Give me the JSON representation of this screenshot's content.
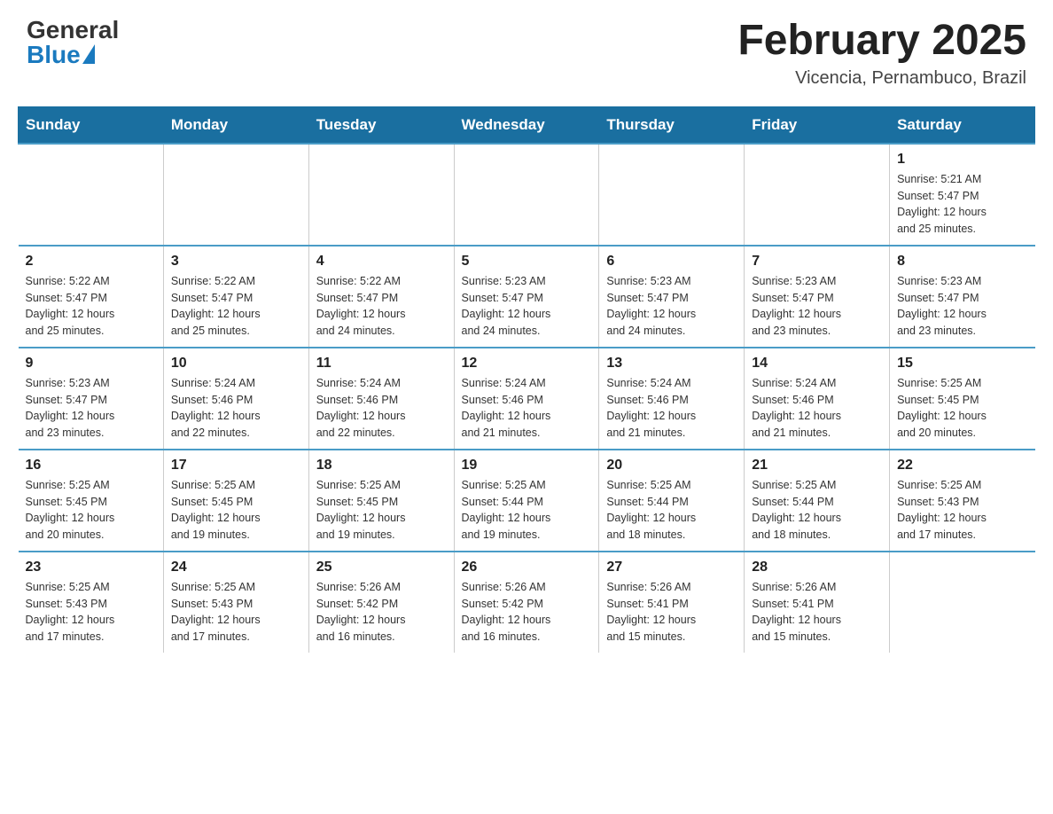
{
  "logo": {
    "general": "General",
    "blue": "Blue"
  },
  "title": "February 2025",
  "location": "Vicencia, Pernambuco, Brazil",
  "days_of_week": [
    "Sunday",
    "Monday",
    "Tuesday",
    "Wednesday",
    "Thursday",
    "Friday",
    "Saturday"
  ],
  "weeks": [
    [
      {
        "day": "",
        "info": ""
      },
      {
        "day": "",
        "info": ""
      },
      {
        "day": "",
        "info": ""
      },
      {
        "day": "",
        "info": ""
      },
      {
        "day": "",
        "info": ""
      },
      {
        "day": "",
        "info": ""
      },
      {
        "day": "1",
        "info": "Sunrise: 5:21 AM\nSunset: 5:47 PM\nDaylight: 12 hours\nand 25 minutes."
      }
    ],
    [
      {
        "day": "2",
        "info": "Sunrise: 5:22 AM\nSunset: 5:47 PM\nDaylight: 12 hours\nand 25 minutes."
      },
      {
        "day": "3",
        "info": "Sunrise: 5:22 AM\nSunset: 5:47 PM\nDaylight: 12 hours\nand 25 minutes."
      },
      {
        "day": "4",
        "info": "Sunrise: 5:22 AM\nSunset: 5:47 PM\nDaylight: 12 hours\nand 24 minutes."
      },
      {
        "day": "5",
        "info": "Sunrise: 5:23 AM\nSunset: 5:47 PM\nDaylight: 12 hours\nand 24 minutes."
      },
      {
        "day": "6",
        "info": "Sunrise: 5:23 AM\nSunset: 5:47 PM\nDaylight: 12 hours\nand 24 minutes."
      },
      {
        "day": "7",
        "info": "Sunrise: 5:23 AM\nSunset: 5:47 PM\nDaylight: 12 hours\nand 23 minutes."
      },
      {
        "day": "8",
        "info": "Sunrise: 5:23 AM\nSunset: 5:47 PM\nDaylight: 12 hours\nand 23 minutes."
      }
    ],
    [
      {
        "day": "9",
        "info": "Sunrise: 5:23 AM\nSunset: 5:47 PM\nDaylight: 12 hours\nand 23 minutes."
      },
      {
        "day": "10",
        "info": "Sunrise: 5:24 AM\nSunset: 5:46 PM\nDaylight: 12 hours\nand 22 minutes."
      },
      {
        "day": "11",
        "info": "Sunrise: 5:24 AM\nSunset: 5:46 PM\nDaylight: 12 hours\nand 22 minutes."
      },
      {
        "day": "12",
        "info": "Sunrise: 5:24 AM\nSunset: 5:46 PM\nDaylight: 12 hours\nand 21 minutes."
      },
      {
        "day": "13",
        "info": "Sunrise: 5:24 AM\nSunset: 5:46 PM\nDaylight: 12 hours\nand 21 minutes."
      },
      {
        "day": "14",
        "info": "Sunrise: 5:24 AM\nSunset: 5:46 PM\nDaylight: 12 hours\nand 21 minutes."
      },
      {
        "day": "15",
        "info": "Sunrise: 5:25 AM\nSunset: 5:45 PM\nDaylight: 12 hours\nand 20 minutes."
      }
    ],
    [
      {
        "day": "16",
        "info": "Sunrise: 5:25 AM\nSunset: 5:45 PM\nDaylight: 12 hours\nand 20 minutes."
      },
      {
        "day": "17",
        "info": "Sunrise: 5:25 AM\nSunset: 5:45 PM\nDaylight: 12 hours\nand 19 minutes."
      },
      {
        "day": "18",
        "info": "Sunrise: 5:25 AM\nSunset: 5:45 PM\nDaylight: 12 hours\nand 19 minutes."
      },
      {
        "day": "19",
        "info": "Sunrise: 5:25 AM\nSunset: 5:44 PM\nDaylight: 12 hours\nand 19 minutes."
      },
      {
        "day": "20",
        "info": "Sunrise: 5:25 AM\nSunset: 5:44 PM\nDaylight: 12 hours\nand 18 minutes."
      },
      {
        "day": "21",
        "info": "Sunrise: 5:25 AM\nSunset: 5:44 PM\nDaylight: 12 hours\nand 18 minutes."
      },
      {
        "day": "22",
        "info": "Sunrise: 5:25 AM\nSunset: 5:43 PM\nDaylight: 12 hours\nand 17 minutes."
      }
    ],
    [
      {
        "day": "23",
        "info": "Sunrise: 5:25 AM\nSunset: 5:43 PM\nDaylight: 12 hours\nand 17 minutes."
      },
      {
        "day": "24",
        "info": "Sunrise: 5:25 AM\nSunset: 5:43 PM\nDaylight: 12 hours\nand 17 minutes."
      },
      {
        "day": "25",
        "info": "Sunrise: 5:26 AM\nSunset: 5:42 PM\nDaylight: 12 hours\nand 16 minutes."
      },
      {
        "day": "26",
        "info": "Sunrise: 5:26 AM\nSunset: 5:42 PM\nDaylight: 12 hours\nand 16 minutes."
      },
      {
        "day": "27",
        "info": "Sunrise: 5:26 AM\nSunset: 5:41 PM\nDaylight: 12 hours\nand 15 minutes."
      },
      {
        "day": "28",
        "info": "Sunrise: 5:26 AM\nSunset: 5:41 PM\nDaylight: 12 hours\nand 15 minutes."
      },
      {
        "day": "",
        "info": ""
      }
    ]
  ]
}
